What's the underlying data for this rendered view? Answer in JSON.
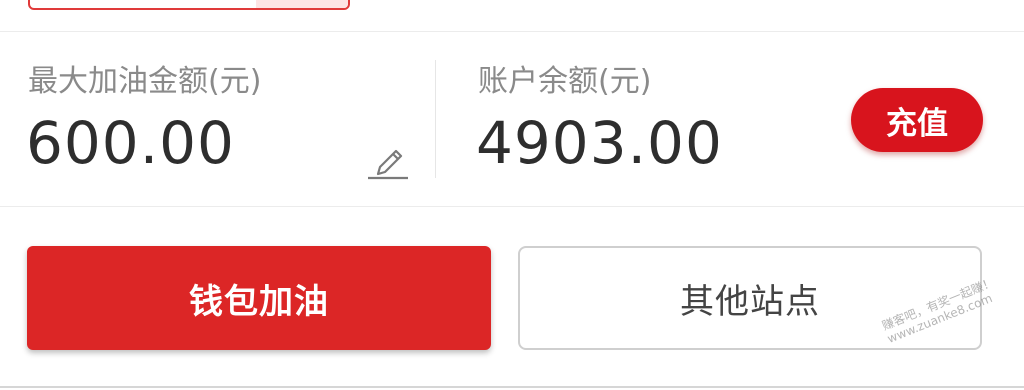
{
  "fuel_info": {
    "max_amount_label": "最大加油金额(元)",
    "max_amount_value": "600.00",
    "balance_label": "账户余额(元)",
    "balance_value": "4903.00",
    "recharge_label": "充值"
  },
  "actions": {
    "wallet_refuel_label": "钱包加油",
    "other_stations_label": "其他站点"
  },
  "watermark": {
    "line1": "赚客吧，有奖一起赚！",
    "line2": "www.zuanke8.com"
  },
  "icons": {
    "edit": "pencil-icon"
  },
  "colors": {
    "accent_red": "#dc2626",
    "recharge_red": "#d8141d",
    "label_gray": "#8a8a8a",
    "amount_text": "#2e2e2e"
  }
}
